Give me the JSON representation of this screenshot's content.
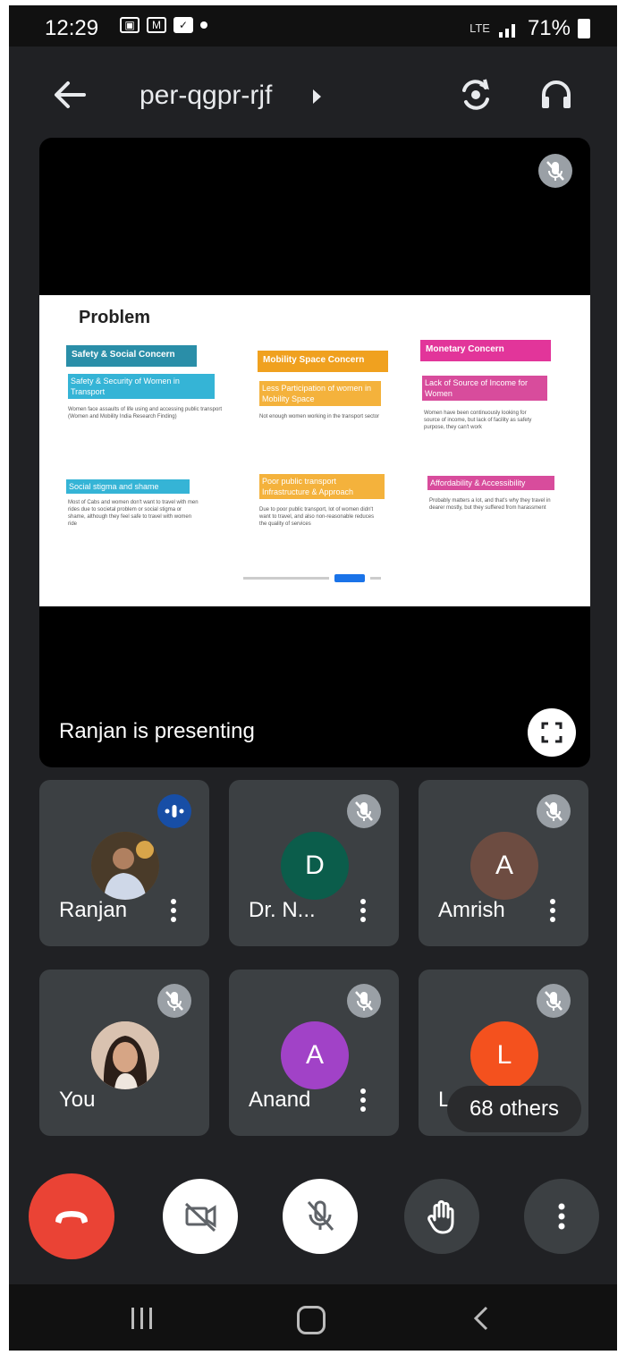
{
  "status_bar": {
    "time": "12:29",
    "notification_icons": [
      "image-icon",
      "gmail-icon",
      "app-icon"
    ],
    "network": "LTE",
    "battery": "71%"
  },
  "meeting": {
    "code": "per-qgpr-rjf",
    "presenting_label": "Ranjan is presenting"
  },
  "slide": {
    "title": "Problem",
    "sections": [
      {
        "heading": "Safety & Social Concern",
        "sub": "Safety & Security of Women in Transport",
        "desc": "Women face assaults of life using and accessing public transport (Women and Mobility India Research Finding)"
      },
      {
        "heading": "Mobility Space Concern",
        "sub": "Less Participation of women in Mobility Space",
        "desc": "Not enough women working in the transport sector"
      },
      {
        "heading": "Monetary Concern",
        "sub": "Lack of Source of Income for Women",
        "desc": "Women have been continuously looking for source of income, but lack of facility as safety purpose, they can't work"
      },
      {
        "heading": "Social stigma and shame",
        "sub": "",
        "desc": "Most of Cabs and women don't want to travel with men rides due to societal problem or social stigma or shame, although they feel safe to travel with women ride"
      },
      {
        "heading": "Poor public transport Infrastructure & Approach",
        "sub": "",
        "desc": "Due to poor public transport, lot of women didn't want to travel, and also non-reasonable reduces the quality of services"
      },
      {
        "heading": "Affordability & Accessibility",
        "sub": "",
        "desc": "Probably matters a lot, and that's why they travel in dearer mostly, but they suffered from harassment"
      }
    ]
  },
  "participants": [
    {
      "name": "Ranjan",
      "initial": "",
      "avatar_color": "#6b5a3e",
      "avatar_type": "photo",
      "status": "speaking"
    },
    {
      "name": "Dr. N...",
      "initial": "D",
      "avatar_color": "#0b5d4b",
      "avatar_type": "initial",
      "status": "muted"
    },
    {
      "name": "Amrish",
      "initial": "A",
      "avatar_color": "#6d4c41",
      "avatar_type": "initial",
      "status": "muted"
    },
    {
      "name": "You",
      "initial": "",
      "avatar_color": "#c7a58e",
      "avatar_type": "photo",
      "status": "muted"
    },
    {
      "name": "Anand",
      "initial": "A",
      "avatar_color": "#a142c7",
      "avatar_type": "initial",
      "status": "muted"
    },
    {
      "name": "L",
      "initial": "L",
      "avatar_color": "#f4511e",
      "avatar_type": "initial",
      "status": "muted"
    }
  ],
  "others_label": "68 others",
  "controls": [
    "end-call",
    "camera-off",
    "mic-off",
    "raise-hand",
    "more-options"
  ],
  "colors": {
    "background": "#202124",
    "tile": "#3c4043",
    "end_call": "#ea4335",
    "speaking": "#174ea6"
  }
}
